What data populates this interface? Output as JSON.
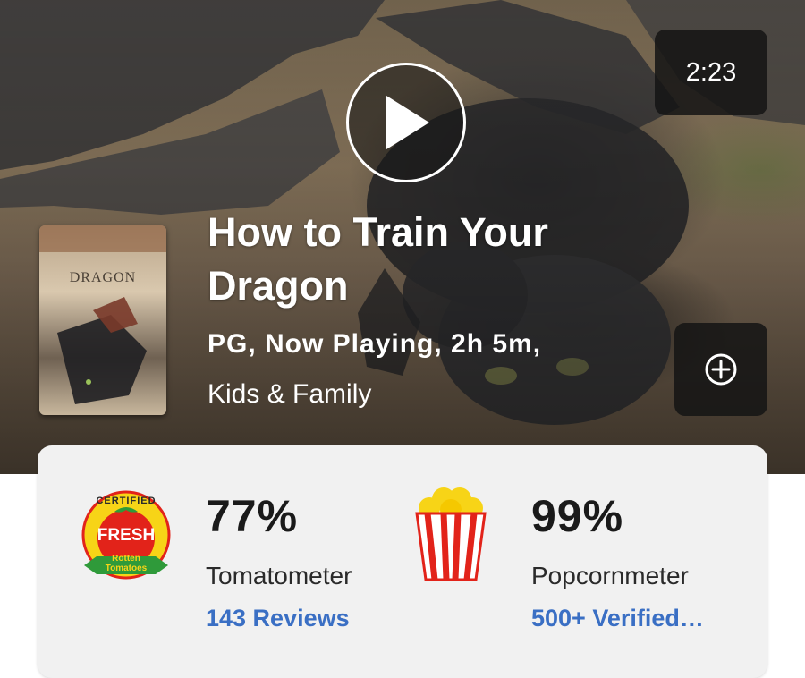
{
  "video": {
    "duration": "2:23",
    "play_icon": "play-icon"
  },
  "poster": {
    "label": "DRAGON",
    "icon": "movie-poster"
  },
  "movie": {
    "title": "How to Train Your Dragon",
    "meta": "PG, Now Playing, 2h 5m,",
    "genre": "Kids & Family"
  },
  "actions": {
    "add_icon": "plus-circle-icon"
  },
  "scores": {
    "tomatometer": {
      "value": "77%",
      "label": "Tomatometer",
      "link": "143 Reviews",
      "badge_top": "CERTIFIED",
      "badge_main": "FRESH",
      "badge_sub_1": "Rotten",
      "badge_sub_2": "Tomatoes",
      "icon": "certified-fresh-icon"
    },
    "popcornmeter": {
      "value": "99%",
      "label": "Popcornmeter",
      "link": "500+ Verified…",
      "icon": "popcorn-icon"
    }
  },
  "colors": {
    "link": "#3a6fc4",
    "fresh_red": "#e2231a",
    "badge_green": "#2f9a3a",
    "badge_yellow": "#f7d417"
  }
}
